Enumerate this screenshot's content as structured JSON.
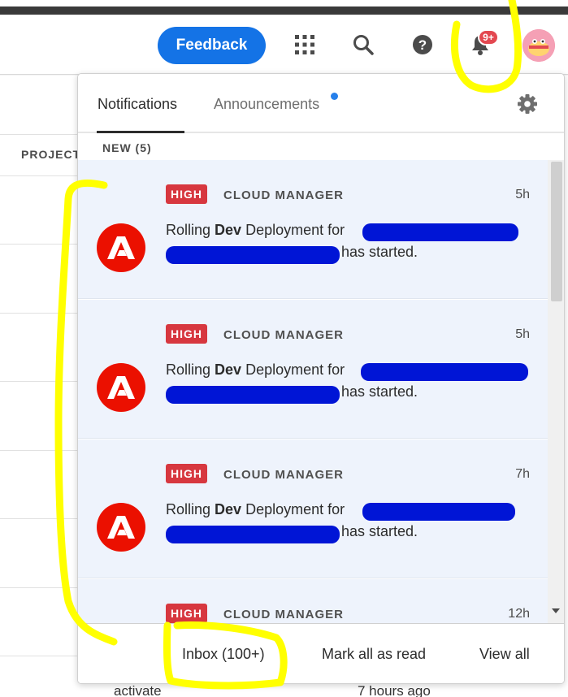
{
  "header": {
    "feedback_label": "Feedback",
    "notification_badge": "9+",
    "icons": [
      "apps-grid-icon",
      "search-icon",
      "help-icon",
      "bell-icon",
      "avatar"
    ]
  },
  "background": {
    "column_header": "PROJECT",
    "bottom_text_left": "activate",
    "bottom_text_right": "7 hours ago"
  },
  "popover": {
    "tabs": [
      {
        "label": "Notifications",
        "active": true
      },
      {
        "label": "Announcements",
        "active": false,
        "has_dot": true
      }
    ],
    "new_label": "NEW (5)",
    "notifications": [
      {
        "priority": "HIGH",
        "source": "CLOUD MANAGER",
        "time": "5h",
        "msg_prefix": "Rolling ",
        "msg_bold": "Dev",
        "msg_suffix": " Deployment for",
        "msg_end": "has started."
      },
      {
        "priority": "HIGH",
        "source": "CLOUD MANAGER",
        "time": "5h",
        "msg_prefix": "Rolling ",
        "msg_bold": "Dev",
        "msg_suffix": " Deployment for",
        "msg_end": "has started."
      },
      {
        "priority": "HIGH",
        "source": "CLOUD MANAGER",
        "time": "7h",
        "msg_prefix": "Rolling ",
        "msg_bold": "Dev",
        "msg_suffix": " Deployment for",
        "msg_end": "has started."
      },
      {
        "priority": "HIGH",
        "source": "CLOUD MANAGER",
        "time": "12h",
        "msg_prefix": "",
        "msg_bold": "",
        "msg_suffix": "",
        "msg_end": ""
      }
    ],
    "footer": {
      "inbox_label": "Inbox (100+)",
      "mark_all_label": "Mark all as read",
      "view_all_label": "View all"
    }
  },
  "colors": {
    "accent_blue": "#1473e6",
    "high_badge": "#d7373f",
    "adobe_red": "#eb1000",
    "unread_bg": "#eef3fc",
    "annotation_yellow": "#ffff00",
    "redaction_blue": "#0015d6"
  }
}
